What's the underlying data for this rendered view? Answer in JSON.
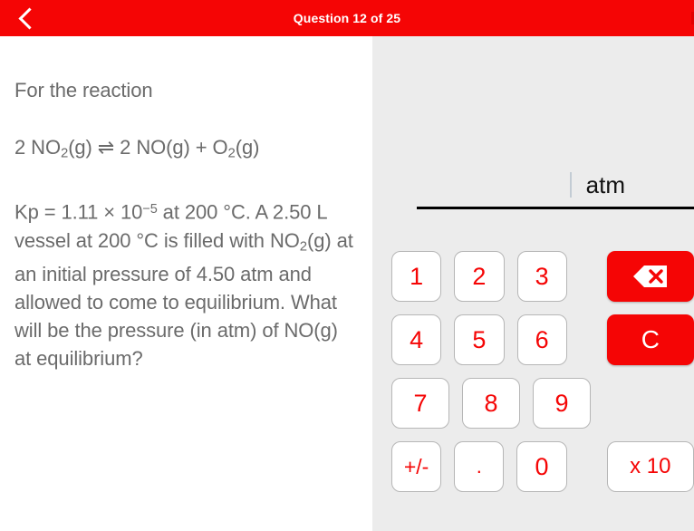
{
  "header": {
    "title": "Question 12 of 25",
    "back_icon": "chevron-left-icon",
    "background_color": "#f50505",
    "text_color": "#ffffff"
  },
  "question": {
    "intro": "For the reaction",
    "equation": {
      "coefficient_reactant": "2",
      "reactant": "NO",
      "reactant_sub": "2",
      "reactant_state": "(g)",
      "arrow": "⇌",
      "coefficient_product1": "2",
      "product1": "NO",
      "product1_state": "(g)",
      "plus": "+",
      "product2": "O",
      "product2_sub": "2",
      "product2_state": "(g)"
    },
    "body_part1": "Kp = 1.11 × 10",
    "body_exponent": "−5",
    "body_part2": " at 200 °C. A 2.50 L vessel at 200 °C is filled with NO",
    "body_sub": "2",
    "body_part3": "(g) at an initial pressure of 4.50 atm and allowed to come to equilibrium. What will be the pressure (in atm) of NO(g) at equilibrium?",
    "text_color": "#6b6b6b"
  },
  "answer": {
    "value": "",
    "unit": "atm",
    "caret_visible": true,
    "underline_color": "#000000"
  },
  "keypad": {
    "rows": [
      {
        "keys": [
          {
            "label": "1",
            "name": "key-1",
            "kind": "digit"
          },
          {
            "label": "2",
            "name": "key-2",
            "kind": "digit"
          },
          {
            "label": "3",
            "name": "key-3",
            "kind": "digit"
          }
        ],
        "action": {
          "label": "",
          "name": "backspace-button",
          "icon": "backspace-delete-icon",
          "kind": "action"
        }
      },
      {
        "keys": [
          {
            "label": "4",
            "name": "key-4",
            "kind": "digit"
          },
          {
            "label": "5",
            "name": "key-5",
            "kind": "digit"
          },
          {
            "label": "6",
            "name": "key-6",
            "kind": "digit"
          }
        ],
        "action": {
          "label": "C",
          "name": "clear-button",
          "icon": "",
          "kind": "action"
        }
      },
      {
        "keys": [
          {
            "label": "7",
            "name": "key-7",
            "kind": "digit"
          },
          {
            "label": "8",
            "name": "key-8",
            "kind": "digit"
          },
          {
            "label": "9",
            "name": "key-9",
            "kind": "digit"
          }
        ],
        "action": null
      },
      {
        "keys": [
          {
            "label": "+/-",
            "name": "key-sign-toggle",
            "kind": "sign"
          },
          {
            "label": ".",
            "name": "key-decimal-point",
            "kind": "dot"
          },
          {
            "label": "0",
            "name": "key-0",
            "kind": "digit"
          }
        ],
        "action": {
          "label": "x 10",
          "name": "scientific-notation-button",
          "icon": "",
          "kind": "exp"
        }
      }
    ],
    "key_text_color": "#f50505",
    "action_bg_color": "#f50505",
    "panel_bg_color": "#ececec"
  }
}
